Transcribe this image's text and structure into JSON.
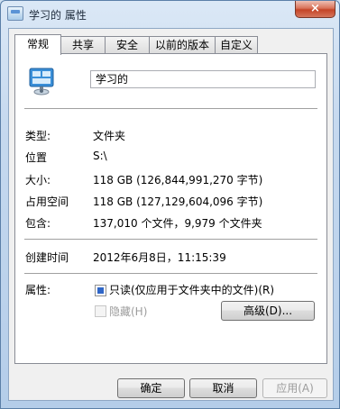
{
  "window": {
    "title": "学习的 属性",
    "close_label": "×"
  },
  "tabs": [
    {
      "label": "常规",
      "active": true
    },
    {
      "label": "共享",
      "active": false
    },
    {
      "label": "安全",
      "active": false
    },
    {
      "label": "以前的版本",
      "active": false
    },
    {
      "label": "自定义",
      "active": false
    }
  ],
  "general": {
    "name_value": "学习的",
    "rows": {
      "type": {
        "label": "类型:",
        "value": "文件夹"
      },
      "location": {
        "label": "位置",
        "value": "S:\\"
      },
      "size": {
        "label": "大小:",
        "value": "118 GB (126,844,991,270 字节)"
      },
      "size_on_disk": {
        "label": "占用空间",
        "value": "118 GB (127,129,604,096 字节)"
      },
      "contains": {
        "label": "包含:",
        "value": "137,010 个文件，9,979 个文件夹"
      },
      "created": {
        "label": "创建时间",
        "value": "2012年6月8日，11:15:39"
      }
    },
    "attributes": {
      "label": "属性:",
      "readonly_label": "只读(仅应用于文件夹中的文件)(R)",
      "readonly_checked": true,
      "hidden_label": "隐藏(H)",
      "hidden_checked": false,
      "advanced_label": "高级(D)..."
    }
  },
  "buttons": {
    "ok": "确定",
    "cancel": "取消",
    "apply": "应用(A)"
  },
  "icons": {
    "window": "folder-properties-icon",
    "folder": "folder-icon"
  }
}
